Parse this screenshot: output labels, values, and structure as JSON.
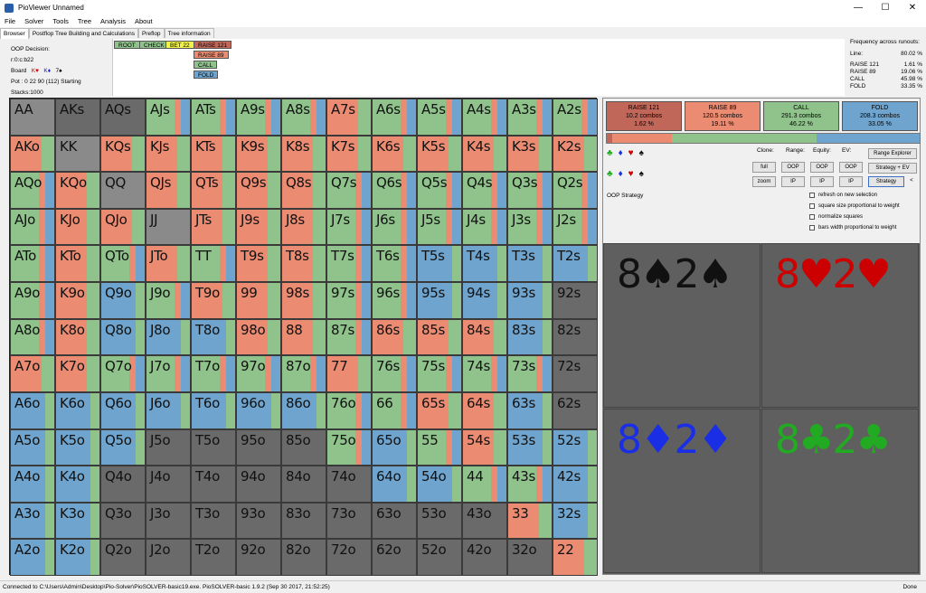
{
  "window": {
    "title": "PioViewer Unnamed",
    "minimize": "—",
    "maximize": "☐",
    "close": "✕"
  },
  "menu": [
    "File",
    "Solver",
    "Tools",
    "Tree",
    "Analysis",
    "About"
  ],
  "tabs": [
    "Browser",
    "Postflop Tree Building and Calculations",
    "Preflop",
    "Tree information"
  ],
  "info": {
    "decision_label": "OOP Decision:",
    "node": "r:0:c:b22",
    "board_label": "Board",
    "board_cards": [
      {
        "t": "K♥",
        "color": "red"
      },
      {
        "t": "K♦",
        "color": "blue"
      },
      {
        "t": "7♠",
        "color": "black"
      }
    ],
    "pot": "Pot : 0 22 90 (112) Starting Stacks:1000"
  },
  "tree_buttons": {
    "root": "ROOT",
    "check": "CHECK",
    "bet": "BET 22",
    "raise121": "RAISE 121",
    "raise89": "RAISE 89",
    "call": "CALL",
    "fold": "FOLD"
  },
  "frequency": {
    "title": "Frequency across runouts:",
    "line_label": "Line:",
    "line_value": "80.02 %",
    "rows": [
      {
        "label": "RAISE 121",
        "value": "1.61 %"
      },
      {
        "label": "RAISE 89",
        "value": "19.06 %"
      },
      {
        "label": "CALL",
        "value": "45.98 %"
      },
      {
        "label": "FOLD",
        "value": "33.35 %"
      }
    ]
  },
  "colors": {
    "raise121": "#c0675a",
    "raise89": "#eb8c72",
    "call": "#8fc38b",
    "fold": "#6ea4ce",
    "empty": "#6a6a6a",
    "pair": "#8a8a8a"
  },
  "actions": [
    {
      "name": "RAISE 121",
      "combos": "10.2 combos",
      "pct": "1.62 %"
    },
    {
      "name": "RAISE 89",
      "combos": "120.5 combos",
      "pct": "19.11 %"
    },
    {
      "name": "CALL",
      "combos": "291.3 combos",
      "pct": "46.22 %"
    },
    {
      "name": "FOLD",
      "combos": "208.3 combos",
      "pct": "33.05 %"
    }
  ],
  "action_freqs": [
    1.62,
    19.11,
    46.22,
    33.05
  ],
  "controls": {
    "clone": "Clone:",
    "range": "Range:",
    "equity": "Equity:",
    "ev": "EV:",
    "full": "full",
    "zoom": "zoom",
    "oop1": "OOP",
    "ip1": "IP",
    "oop2": "OOP",
    "ip2": "IP",
    "oop3": "OOP",
    "ip3": "IP",
    "range_explorer": "Range Explorer",
    "strategy_ev": "Strategy + EV",
    "strategy": "Strategy",
    "arrow": "<",
    "oop_strategy": "OOP Strategy"
  },
  "checkboxes": [
    "refresh on new selection",
    "square size proportional to weight",
    "normalize squares",
    "bars width proportional to weight"
  ],
  "suits_row": [
    "♣",
    "♦",
    "♥",
    "♠"
  ],
  "cards": [
    {
      "label": "8♠2♠",
      "color": "#111111"
    },
    {
      "label": "8♥2♥",
      "color": "#cc0000"
    },
    {
      "label": "8♦2♦",
      "color": "#1a2ee6"
    },
    {
      "label": "8♣2♣",
      "color": "#22aa22"
    }
  ],
  "hands": [
    [
      "AA",
      "AKs",
      "AQs",
      "AJs",
      "ATs",
      "A9s",
      "A8s",
      "A7s",
      "A6s",
      "A5s",
      "A4s",
      "A3s",
      "A2s"
    ],
    [
      "AKo",
      "KK",
      "KQs",
      "KJs",
      "KTs",
      "K9s",
      "K8s",
      "K7s",
      "K6s",
      "K5s",
      "K4s",
      "K3s",
      "K2s"
    ],
    [
      "AQo",
      "KQo",
      "QQ",
      "QJs",
      "QTs",
      "Q9s",
      "Q8s",
      "Q7s",
      "Q6s",
      "Q5s",
      "Q4s",
      "Q3s",
      "Q2s"
    ],
    [
      "AJo",
      "KJo",
      "QJo",
      "JJ",
      "JTs",
      "J9s",
      "J8s",
      "J7s",
      "J6s",
      "J5s",
      "J4s",
      "J3s",
      "J2s"
    ],
    [
      "ATo",
      "KTo",
      "QTo",
      "JTo",
      "TT",
      "T9s",
      "T8s",
      "T7s",
      "T6s",
      "T5s",
      "T4s",
      "T3s",
      "T2s"
    ],
    [
      "A9o",
      "K9o",
      "Q9o",
      "J9o",
      "T9o",
      "99",
      "98s",
      "97s",
      "96s",
      "95s",
      "94s",
      "93s",
      "92s"
    ],
    [
      "A8o",
      "K8o",
      "Q8o",
      "J8o",
      "T8o",
      "98o",
      "88",
      "87s",
      "86s",
      "85s",
      "84s",
      "83s",
      "82s"
    ],
    [
      "A7o",
      "K7o",
      "Q7o",
      "J7o",
      "T7o",
      "97o",
      "87o",
      "77",
      "76s",
      "75s",
      "74s",
      "73s",
      "72s"
    ],
    [
      "A6o",
      "K6o",
      "Q6o",
      "J6o",
      "T6o",
      "96o",
      "86o",
      "76o",
      "66",
      "65s",
      "64s",
      "63s",
      "62s"
    ],
    [
      "A5o",
      "K5o",
      "Q5o",
      "J5o",
      "T5o",
      "95o",
      "85o",
      "75o",
      "65o",
      "55",
      "54s",
      "53s",
      "52s"
    ],
    [
      "A4o",
      "K4o",
      "Q4o",
      "J4o",
      "T4o",
      "94o",
      "84o",
      "74o",
      "64o",
      "54o",
      "44",
      "43s",
      "42s"
    ],
    [
      "A3o",
      "K3o",
      "Q3o",
      "J3o",
      "T3o",
      "93o",
      "83o",
      "73o",
      "63o",
      "53o",
      "43o",
      "33",
      "32s"
    ],
    [
      "A2o",
      "K2o",
      "Q2o",
      "J2o",
      "T2o",
      "92o",
      "82o",
      "72o",
      "62o",
      "52o",
      "42o",
      "32o",
      "22"
    ]
  ],
  "hand_strategies": [
    [
      "E",
      "E",
      "E",
      "C",
      "C",
      "C",
      "C",
      "R",
      "C",
      "C",
      "C",
      "C",
      "C"
    ],
    [
      "R",
      "E",
      "R",
      "R",
      "R",
      "R",
      "R",
      "R",
      "R",
      "R",
      "R",
      "R",
      "R"
    ],
    [
      "C",
      "R",
      "E",
      "R",
      "R",
      "R",
      "R",
      "C",
      "C",
      "C",
      "C",
      "C",
      "C"
    ],
    [
      "C",
      "R",
      "R",
      "E",
      "R",
      "R",
      "R",
      "C",
      "C",
      "C",
      "C",
      "C",
      "C"
    ],
    [
      "C",
      "R",
      "C",
      "R",
      "C",
      "R",
      "R",
      "C",
      "C",
      "F",
      "F",
      "F",
      "F"
    ],
    [
      "C",
      "R",
      "F",
      "C",
      "R",
      "R",
      "R",
      "C",
      "C",
      "F",
      "F",
      "F",
      "E"
    ],
    [
      "C",
      "R",
      "F",
      "F",
      "F",
      "R",
      "R",
      "C",
      "R",
      "R",
      "R",
      "F",
      "E"
    ],
    [
      "R",
      "R",
      "C",
      "C",
      "C",
      "C",
      "C",
      "R",
      "C",
      "C",
      "C",
      "C",
      "E"
    ],
    [
      "F",
      "F",
      "F",
      "F",
      "F",
      "F",
      "F",
      "C",
      "C",
      "R",
      "R",
      "F",
      "E"
    ],
    [
      "F",
      "F",
      "F",
      "E",
      "E",
      "E",
      "E",
      "C",
      "F",
      "C",
      "R",
      "F",
      "F"
    ],
    [
      "F",
      "F",
      "E",
      "E",
      "E",
      "E",
      "E",
      "E",
      "F",
      "F",
      "C",
      "C",
      "F"
    ],
    [
      "F",
      "F",
      "E",
      "E",
      "E",
      "E",
      "E",
      "E",
      "E",
      "E",
      "E",
      "R",
      "F"
    ],
    [
      "F",
      "F",
      "E",
      "E",
      "E",
      "E",
      "E",
      "E",
      "E",
      "E",
      "E",
      "E",
      "R"
    ]
  ],
  "status": {
    "left": "Connected to C:\\Users\\Admin\\Desktop\\Pio-Solver\\PioSOLVER-basic19.exe. PioSOLVER-basic 1.9.2 (Sep 30 2017, 21:52:25)",
    "right": "Done"
  }
}
